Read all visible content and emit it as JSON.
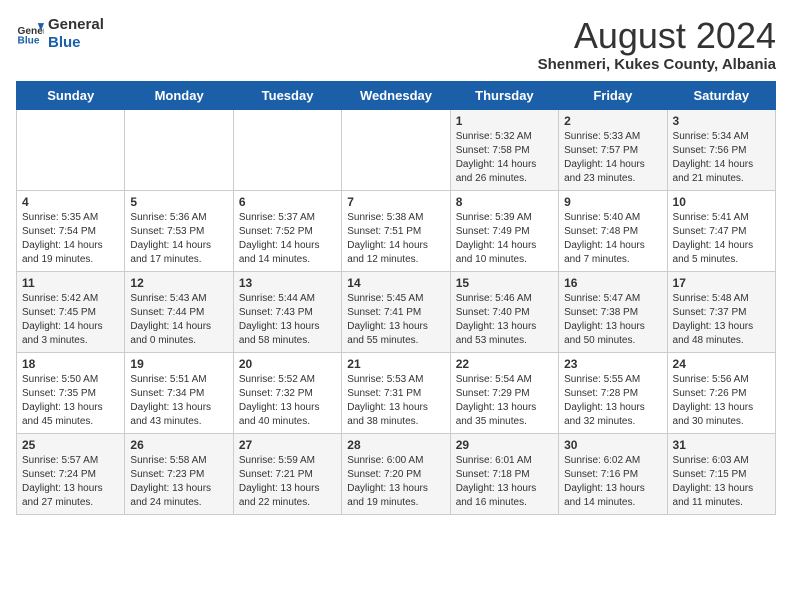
{
  "header": {
    "logo_general": "General",
    "logo_blue": "Blue",
    "main_title": "August 2024",
    "subtitle": "Shenmeri, Kukes County, Albania"
  },
  "days_of_week": [
    "Sunday",
    "Monday",
    "Tuesday",
    "Wednesday",
    "Thursday",
    "Friday",
    "Saturday"
  ],
  "weeks": [
    [
      {
        "day": "",
        "info": ""
      },
      {
        "day": "",
        "info": ""
      },
      {
        "day": "",
        "info": ""
      },
      {
        "day": "",
        "info": ""
      },
      {
        "day": "1",
        "info": "Sunrise: 5:32 AM\nSunset: 7:58 PM\nDaylight: 14 hours and 26 minutes."
      },
      {
        "day": "2",
        "info": "Sunrise: 5:33 AM\nSunset: 7:57 PM\nDaylight: 14 hours and 23 minutes."
      },
      {
        "day": "3",
        "info": "Sunrise: 5:34 AM\nSunset: 7:56 PM\nDaylight: 14 hours and 21 minutes."
      }
    ],
    [
      {
        "day": "4",
        "info": "Sunrise: 5:35 AM\nSunset: 7:54 PM\nDaylight: 14 hours and 19 minutes."
      },
      {
        "day": "5",
        "info": "Sunrise: 5:36 AM\nSunset: 7:53 PM\nDaylight: 14 hours and 17 minutes."
      },
      {
        "day": "6",
        "info": "Sunrise: 5:37 AM\nSunset: 7:52 PM\nDaylight: 14 hours and 14 minutes."
      },
      {
        "day": "7",
        "info": "Sunrise: 5:38 AM\nSunset: 7:51 PM\nDaylight: 14 hours and 12 minutes."
      },
      {
        "day": "8",
        "info": "Sunrise: 5:39 AM\nSunset: 7:49 PM\nDaylight: 14 hours and 10 minutes."
      },
      {
        "day": "9",
        "info": "Sunrise: 5:40 AM\nSunset: 7:48 PM\nDaylight: 14 hours and 7 minutes."
      },
      {
        "day": "10",
        "info": "Sunrise: 5:41 AM\nSunset: 7:47 PM\nDaylight: 14 hours and 5 minutes."
      }
    ],
    [
      {
        "day": "11",
        "info": "Sunrise: 5:42 AM\nSunset: 7:45 PM\nDaylight: 14 hours and 3 minutes."
      },
      {
        "day": "12",
        "info": "Sunrise: 5:43 AM\nSunset: 7:44 PM\nDaylight: 14 hours and 0 minutes."
      },
      {
        "day": "13",
        "info": "Sunrise: 5:44 AM\nSunset: 7:43 PM\nDaylight: 13 hours and 58 minutes."
      },
      {
        "day": "14",
        "info": "Sunrise: 5:45 AM\nSunset: 7:41 PM\nDaylight: 13 hours and 55 minutes."
      },
      {
        "day": "15",
        "info": "Sunrise: 5:46 AM\nSunset: 7:40 PM\nDaylight: 13 hours and 53 minutes."
      },
      {
        "day": "16",
        "info": "Sunrise: 5:47 AM\nSunset: 7:38 PM\nDaylight: 13 hours and 50 minutes."
      },
      {
        "day": "17",
        "info": "Sunrise: 5:48 AM\nSunset: 7:37 PM\nDaylight: 13 hours and 48 minutes."
      }
    ],
    [
      {
        "day": "18",
        "info": "Sunrise: 5:50 AM\nSunset: 7:35 PM\nDaylight: 13 hours and 45 minutes."
      },
      {
        "day": "19",
        "info": "Sunrise: 5:51 AM\nSunset: 7:34 PM\nDaylight: 13 hours and 43 minutes."
      },
      {
        "day": "20",
        "info": "Sunrise: 5:52 AM\nSunset: 7:32 PM\nDaylight: 13 hours and 40 minutes."
      },
      {
        "day": "21",
        "info": "Sunrise: 5:53 AM\nSunset: 7:31 PM\nDaylight: 13 hours and 38 minutes."
      },
      {
        "day": "22",
        "info": "Sunrise: 5:54 AM\nSunset: 7:29 PM\nDaylight: 13 hours and 35 minutes."
      },
      {
        "day": "23",
        "info": "Sunrise: 5:55 AM\nSunset: 7:28 PM\nDaylight: 13 hours and 32 minutes."
      },
      {
        "day": "24",
        "info": "Sunrise: 5:56 AM\nSunset: 7:26 PM\nDaylight: 13 hours and 30 minutes."
      }
    ],
    [
      {
        "day": "25",
        "info": "Sunrise: 5:57 AM\nSunset: 7:24 PM\nDaylight: 13 hours and 27 minutes."
      },
      {
        "day": "26",
        "info": "Sunrise: 5:58 AM\nSunset: 7:23 PM\nDaylight: 13 hours and 24 minutes."
      },
      {
        "day": "27",
        "info": "Sunrise: 5:59 AM\nSunset: 7:21 PM\nDaylight: 13 hours and 22 minutes."
      },
      {
        "day": "28",
        "info": "Sunrise: 6:00 AM\nSunset: 7:20 PM\nDaylight: 13 hours and 19 minutes."
      },
      {
        "day": "29",
        "info": "Sunrise: 6:01 AM\nSunset: 7:18 PM\nDaylight: 13 hours and 16 minutes."
      },
      {
        "day": "30",
        "info": "Sunrise: 6:02 AM\nSunset: 7:16 PM\nDaylight: 13 hours and 14 minutes."
      },
      {
        "day": "31",
        "info": "Sunrise: 6:03 AM\nSunset: 7:15 PM\nDaylight: 13 hours and 11 minutes."
      }
    ]
  ]
}
